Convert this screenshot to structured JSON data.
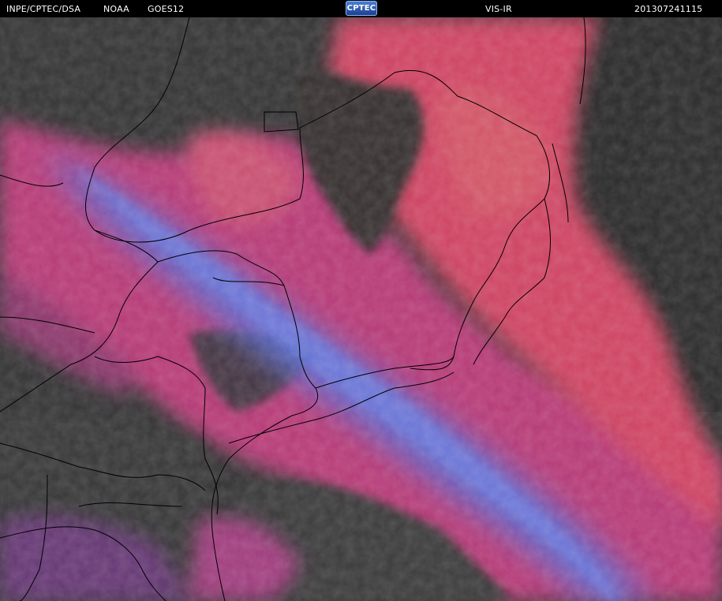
{
  "header": {
    "institution": "INPE/CPTEC/DSA",
    "agency": "NOAA",
    "satellite": "GOES12",
    "logo_text": "CPTEC",
    "product": "VIS-IR",
    "timestamp": "201307241115"
  },
  "colors": {
    "background_land": "#3c3c3c",
    "cloud_magenta": "#c0407a",
    "cloud_red": "#d8465c",
    "cloud_blue": "#5a6fd0",
    "borders": "#000000"
  }
}
